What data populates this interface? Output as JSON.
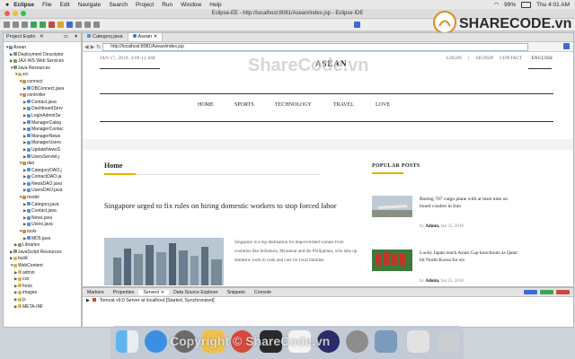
{
  "menubar": {
    "app": "Eclipse",
    "items": [
      "File",
      "Edit",
      "Navigate",
      "Search",
      "Project",
      "Run",
      "Window",
      "Help"
    ],
    "battery": "99%",
    "clock": "Thu 4:01 AM"
  },
  "window_title": "Eclipse-EE - http://localhost:8081/Asean/index.jsp - Eclipse IDE",
  "logo": {
    "brand": "SHARECODE.vn"
  },
  "left_panel": {
    "title": "Project Explo",
    "tree": [
      {
        "label": "Asean",
        "indent": 0,
        "icon": "proj",
        "tw": "▼"
      },
      {
        "label": "Deployment Descriptor",
        "indent": 1,
        "icon": "lib",
        "tw": "▶"
      },
      {
        "label": "JAX-WS Web Services",
        "indent": 1,
        "icon": "lib",
        "tw": "▶"
      },
      {
        "label": "Java Resources",
        "indent": 1,
        "icon": "lib",
        "tw": "▼"
      },
      {
        "label": "src",
        "indent": 2,
        "icon": "folder",
        "tw": "▼"
      },
      {
        "label": "connect",
        "indent": 3,
        "icon": "pkg",
        "tw": "▼"
      },
      {
        "label": "DBConnect.java",
        "indent": 4,
        "icon": "java",
        "tw": "▶"
      },
      {
        "label": "controller",
        "indent": 3,
        "icon": "pkg",
        "tw": "▼"
      },
      {
        "label": "Contact.java",
        "indent": 4,
        "icon": "java",
        "tw": "▶"
      },
      {
        "label": "DashboardServ",
        "indent": 4,
        "icon": "java",
        "tw": "▶"
      },
      {
        "label": "LoginAdminSe",
        "indent": 4,
        "icon": "java",
        "tw": "▶"
      },
      {
        "label": "ManagerCateg",
        "indent": 4,
        "icon": "java",
        "tw": "▶"
      },
      {
        "label": "ManagerContac",
        "indent": 4,
        "icon": "java",
        "tw": "▶"
      },
      {
        "label": "ManagerNews",
        "indent": 4,
        "icon": "java",
        "tw": "▶"
      },
      {
        "label": "ManagerUsers",
        "indent": 4,
        "icon": "java",
        "tw": "▶"
      },
      {
        "label": "UpdateNewsS",
        "indent": 4,
        "icon": "java",
        "tw": "▶"
      },
      {
        "label": "UsersServlet.j",
        "indent": 4,
        "icon": "java",
        "tw": "▶"
      },
      {
        "label": "dao",
        "indent": 3,
        "icon": "pkg",
        "tw": "▼"
      },
      {
        "label": "CategoryDAO.j",
        "indent": 4,
        "icon": "java",
        "tw": "▶"
      },
      {
        "label": "ContactDAO.ja",
        "indent": 4,
        "icon": "java",
        "tw": "▶"
      },
      {
        "label": "NewsDAO.java",
        "indent": 4,
        "icon": "java",
        "tw": "▶"
      },
      {
        "label": "UsersDAO.java",
        "indent": 4,
        "icon": "java",
        "tw": "▶"
      },
      {
        "label": "model",
        "indent": 3,
        "icon": "pkg",
        "tw": "▼"
      },
      {
        "label": "Category.java",
        "indent": 4,
        "icon": "java",
        "tw": "▶"
      },
      {
        "label": "Contact.java",
        "indent": 4,
        "icon": "java",
        "tw": "▶"
      },
      {
        "label": "News.java",
        "indent": 4,
        "icon": "java",
        "tw": "▶"
      },
      {
        "label": "Users.java",
        "indent": 4,
        "icon": "java",
        "tw": "▶"
      },
      {
        "label": "tools",
        "indent": 3,
        "icon": "pkg",
        "tw": "▼"
      },
      {
        "label": "MD5.java",
        "indent": 4,
        "icon": "java",
        "tw": "▶"
      },
      {
        "label": "Libraries",
        "indent": 2,
        "icon": "lib",
        "tw": "▶"
      },
      {
        "label": "JavaScript Resources",
        "indent": 1,
        "icon": "lib",
        "tw": "▶"
      },
      {
        "label": "build",
        "indent": 1,
        "icon": "folder",
        "tw": "▶"
      },
      {
        "label": "WebContent",
        "indent": 1,
        "icon": "folder",
        "tw": "▼"
      },
      {
        "label": "admin",
        "indent": 2,
        "icon": "folder",
        "tw": "▶"
      },
      {
        "label": "css",
        "indent": 2,
        "icon": "folder",
        "tw": "▶"
      },
      {
        "label": "fonts",
        "indent": 2,
        "icon": "folder",
        "tw": "▶"
      },
      {
        "label": "images",
        "indent": 2,
        "icon": "folder",
        "tw": "▶"
      },
      {
        "label": "js",
        "indent": 2,
        "icon": "folder",
        "tw": "▶"
      },
      {
        "label": "META-INF",
        "indent": 2,
        "icon": "folder",
        "tw": "▶"
      }
    ]
  },
  "editor": {
    "tabs": [
      {
        "label": "Category.java"
      },
      {
        "label": "Asean ✕"
      }
    ],
    "url": "http://localhost:8081/Asean/index.jsp"
  },
  "webpage": {
    "date": "JAN 17, 2019, 4:00:12 AM",
    "site_title": "ASEAN",
    "top_links": [
      "LOGIN",
      "SIGNUP",
      "CONTACT",
      "ENGLISH"
    ],
    "nav": [
      "HOME",
      "SPORTS",
      "TECHNOLOGY",
      "TRAVEL",
      "LOVE"
    ],
    "section_home": "Home",
    "headline": "Singapore urged to fix rules on hiring domestic workers to stop forced labor",
    "excerpt": "Singapore is a top destination for impoverished women from countries like Indonesia, Myanmar and the Philippines, who take up domestic work to cook and care for local families.",
    "popular_title": "POPULAR POSTS",
    "popular": [
      {
        "title": "Boeing 707 cargo plane with at least nine on board crashes in Iran",
        "by": "by",
        "author": "Admin,",
        "date": "Jan 25, 2018"
      },
      {
        "title": "Lucky Japan reach Asian Cup knockouts as Qatar hit North Korea for six",
        "by": "by",
        "author": "Admin,",
        "date": "Jan 25, 2018"
      }
    ]
  },
  "bottom_panel": {
    "tabs": [
      "Markers",
      "Properties",
      "Servers ✕",
      "Data Source Explorer",
      "Snippets",
      "Console"
    ],
    "server_row": "Tomcat v9.0 Server at localhost  [Started, Synchronized]"
  },
  "watermarks": {
    "center": "ShareCode.vn",
    "bottom": "Copyright © ShareCode.vn"
  }
}
